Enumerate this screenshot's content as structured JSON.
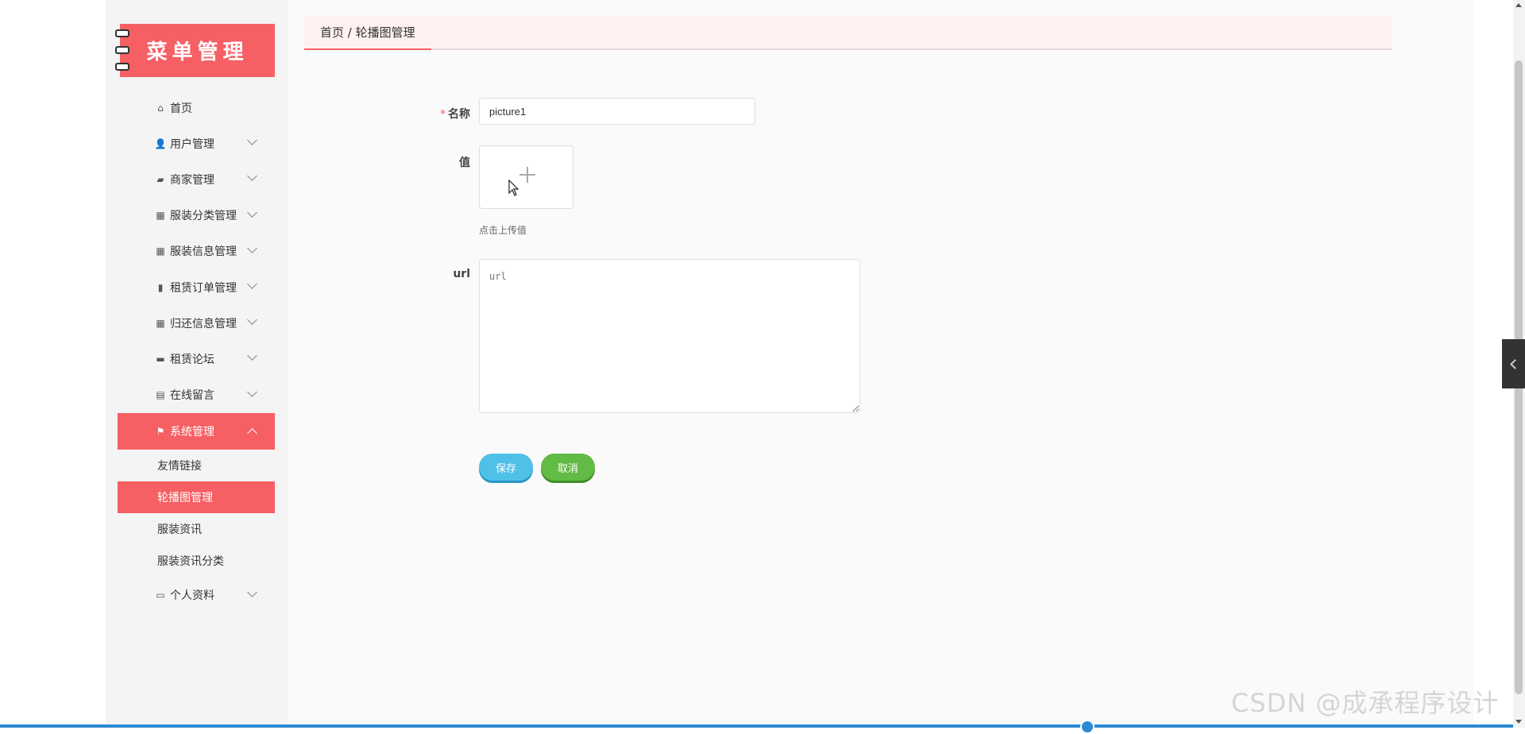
{
  "sidebar": {
    "logo_text": "菜单管理",
    "items": [
      {
        "label": "首页",
        "icon": "home-icon",
        "glyph": "⌂",
        "has_arrow": false
      },
      {
        "label": "用户管理",
        "icon": "user-icon",
        "glyph": "👤",
        "has_arrow": true
      },
      {
        "label": "商家管理",
        "icon": "wallet-icon",
        "glyph": "▰",
        "has_arrow": true
      },
      {
        "label": "服装分类管理",
        "icon": "grid-icon",
        "glyph": "▦",
        "has_arrow": true
      },
      {
        "label": "服装信息管理",
        "icon": "grid-icon",
        "glyph": "▦",
        "has_arrow": true
      },
      {
        "label": "租赁订单管理",
        "icon": "bar-chart-icon",
        "glyph": "▮",
        "has_arrow": true
      },
      {
        "label": "归还信息管理",
        "icon": "grid-icon",
        "glyph": "▦",
        "has_arrow": true
      },
      {
        "label": "租赁论坛",
        "icon": "monitor-icon",
        "glyph": "▬",
        "has_arrow": true
      },
      {
        "label": "在线留言",
        "icon": "clipboard-icon",
        "glyph": "▤",
        "has_arrow": true
      },
      {
        "label": "系统管理",
        "icon": "flag-icon",
        "glyph": "⚑",
        "has_arrow": true,
        "active": true
      }
    ],
    "sub_items": [
      "友情链接",
      "轮播图管理",
      "服装资讯",
      "服装资讯分类"
    ],
    "current_sub": "轮播图管理",
    "last_item": {
      "label": "个人资料",
      "icon": "id-card-icon",
      "glyph": "▭"
    }
  },
  "breadcrumb": "首页 / 轮播图管理",
  "form": {
    "name_label": "名称",
    "required_mark": "*",
    "name_value": "picture1",
    "value_label": "值",
    "upload_hint": "点击上传值",
    "url_label": "url",
    "url_placeholder": "url",
    "save_label": "保存",
    "cancel_label": "取消"
  },
  "watermark": "CSDN @成承程序设计",
  "colors": {
    "accent": "#f65f64",
    "save": "#4fc0e8",
    "cancel": "#62bb44"
  }
}
